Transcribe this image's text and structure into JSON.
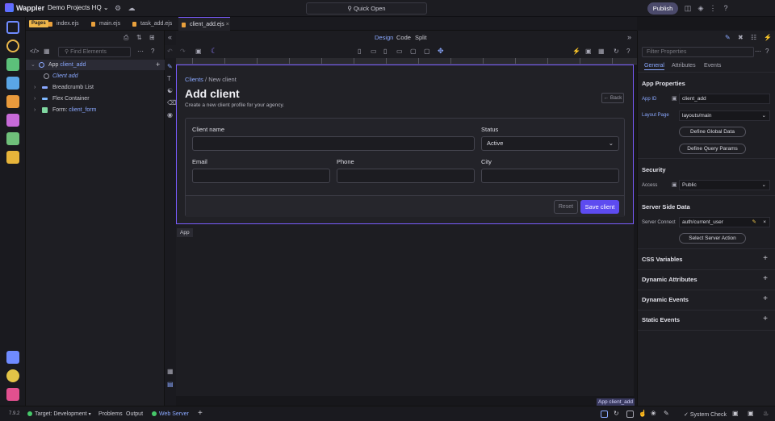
{
  "app": {
    "name": "Wappler",
    "project": "Demo Projects HQ",
    "quick_open": "Quick Open",
    "publish": "Publish",
    "version": "7.9.2"
  },
  "tabs": {
    "pages_badge": "Pages",
    "files": [
      "index.ejs",
      "main.ejs",
      "task_add.ejs",
      "client_add.ejs"
    ],
    "active": "client_add.ejs"
  },
  "layers": {
    "find_placeholder": "Find Elements",
    "tree": [
      {
        "type": "App",
        "name": "client_add"
      },
      {
        "type": "Client add",
        "name": ""
      },
      {
        "type": "Breadcrumb List",
        "name": ""
      },
      {
        "type": "Flex Container",
        "name": ""
      },
      {
        "type": "Form:",
        "name": "client_form"
      }
    ]
  },
  "editor": {
    "modes": [
      "Design",
      "Code",
      "Split"
    ],
    "active_mode": "Design"
  },
  "page": {
    "breadcrumb": {
      "link": "Clients",
      "separator": "/",
      "current": "New client"
    },
    "title": "Add client",
    "subtitle": "Create a new client profile for your agency.",
    "back": "Back",
    "form": {
      "client_name_label": "Client name",
      "status_label": "Status",
      "status_value": "Active",
      "email_label": "Email",
      "phone_label": "Phone",
      "city_label": "City",
      "reset": "Reset",
      "save": "Save client"
    },
    "app_tag": "App",
    "bottom_tag": "App client_add"
  },
  "properties": {
    "filter_placeholder": "Filter Properties",
    "tabs": [
      "General",
      "Attributes",
      "Events"
    ],
    "app_properties": "App Properties",
    "app_id_label": "App ID",
    "app_id": "client_add",
    "layout_label": "Layout Page",
    "layout": "layouts/main",
    "define_global": "Define Global Data",
    "define_query": "Define Query Params",
    "security": "Security",
    "access_label": "Access",
    "access": "Public",
    "ssd": "Server Side Data",
    "server_connect_label": "Server Connect",
    "server_connect": "auth/current_user",
    "select_action": "Select Server Action",
    "collapsed": [
      "CSS Variables",
      "Dynamic Attributes",
      "Dynamic Events",
      "Static Events"
    ]
  },
  "status": {
    "target_label": "Target:",
    "target": "Development",
    "problems": "Problems",
    "output": "Output",
    "web_server": "Web Server",
    "system_check": "System Check"
  },
  "colors": {
    "accent": "#7a5cff",
    "save_button": "#5d4bf0",
    "link": "#8aa8ff",
    "pages_badge": "#efb64a",
    "server_ok": "#46c86a"
  }
}
